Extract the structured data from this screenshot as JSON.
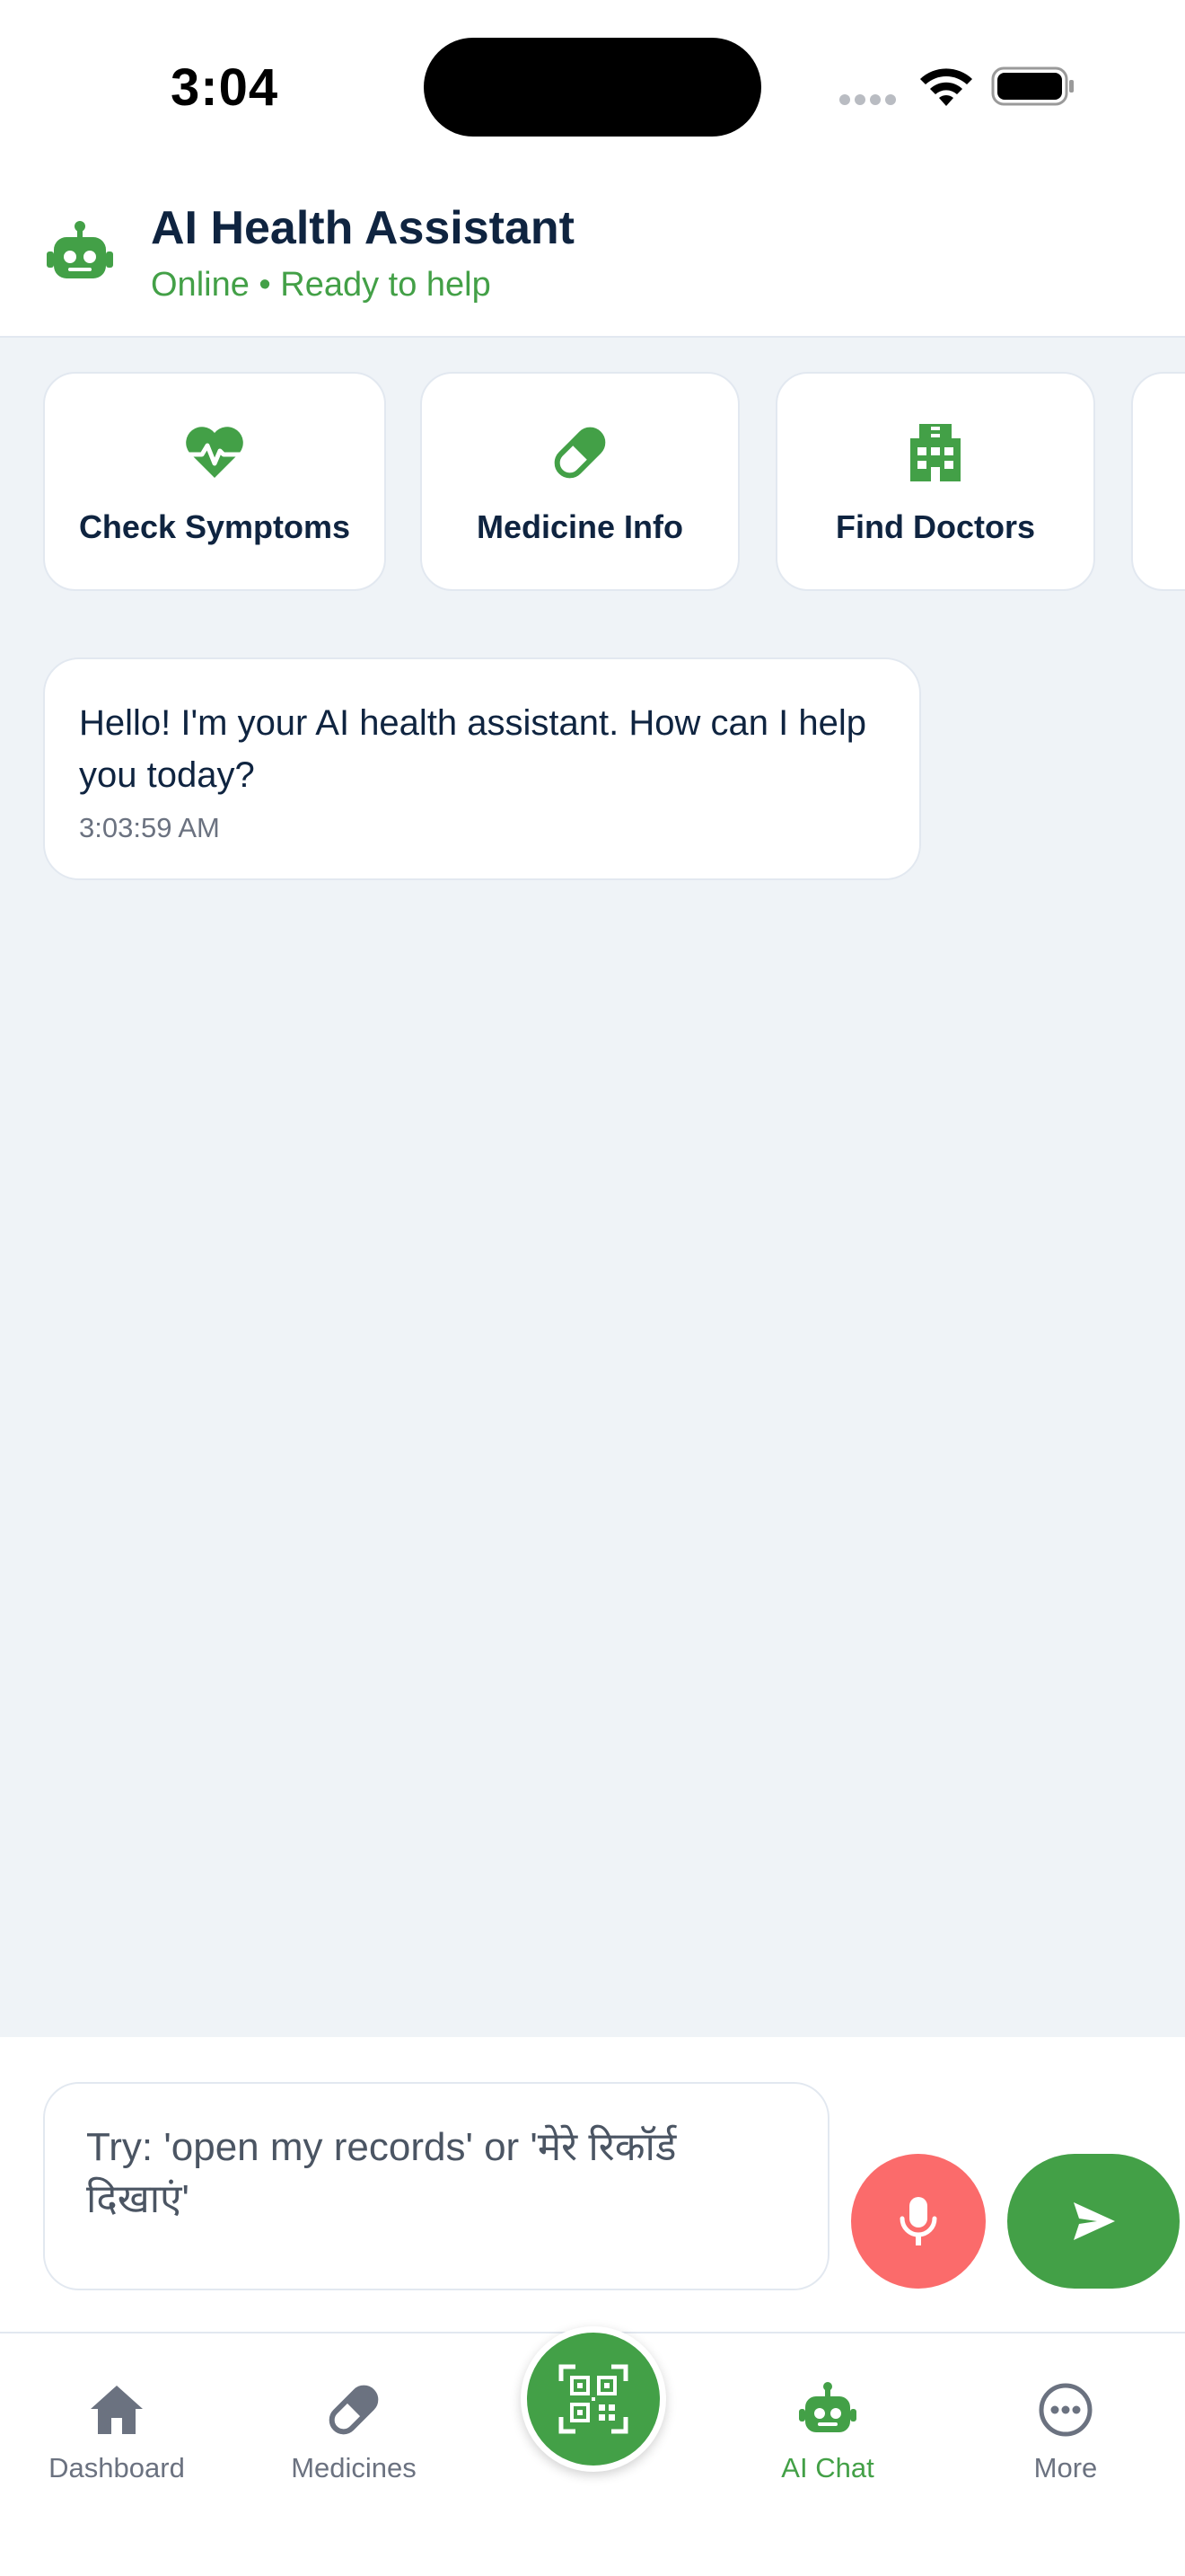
{
  "status_bar": {
    "time": "3:04"
  },
  "header": {
    "title": "AI Health Assistant",
    "status": "Online • Ready to help",
    "icon": "robot-icon"
  },
  "quick_actions": [
    {
      "label": "Check Symptoms",
      "icon": "heart-pulse-icon"
    },
    {
      "label": "Medicine Info",
      "icon": "pill-icon"
    },
    {
      "label": "Find Doctors",
      "icon": "hospital-icon"
    },
    {
      "label": "",
      "icon": ""
    }
  ],
  "messages": [
    {
      "sender": "assistant",
      "text": "Hello! I'm your AI health assistant. How can I help you today?",
      "time": "3:03:59 AM"
    }
  ],
  "composer": {
    "placeholder": "Try: 'open my records' or 'मेरे रिकॉर्ड दिखाएं'",
    "mic_icon": "microphone-icon",
    "send_icon": "send-icon"
  },
  "tabbar": {
    "items": [
      {
        "label": "Dashboard",
        "icon": "home-icon",
        "active": false
      },
      {
        "label": "Medicines",
        "icon": "pill-icon",
        "active": false
      },
      {
        "label": "AI Chat",
        "icon": "robot-icon",
        "active": true
      },
      {
        "label": "More",
        "icon": "more-icon",
        "active": false
      }
    ],
    "scan_icon": "qr-scan-icon"
  },
  "colors": {
    "accent": "#43a047",
    "mic": "#fb6b6b",
    "background": "#eff3f7",
    "text": "#0f2440"
  }
}
